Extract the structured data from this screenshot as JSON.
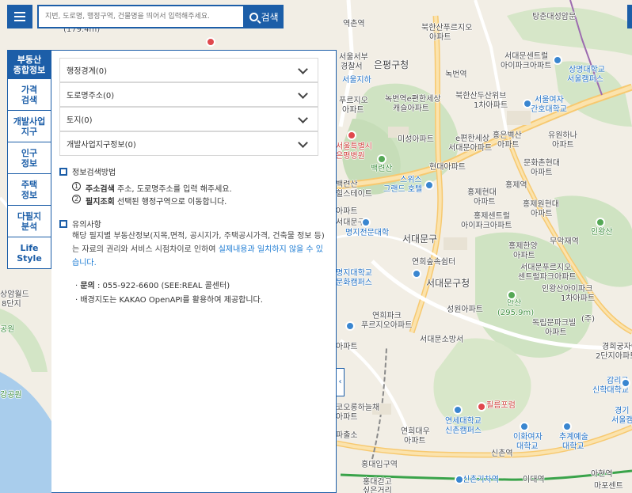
{
  "search": {
    "placeholder": "지번, 도로명, 행정구역, 건물명을 띄어서 입력해주세요.",
    "button": "검색"
  },
  "tabs": [
    {
      "label": "부동산\n종합정보"
    },
    {
      "label": "가격\n검색"
    },
    {
      "label": "개발사업\n지구"
    },
    {
      "label": "인구\n정보"
    },
    {
      "label": "주택\n정보"
    },
    {
      "label": "다필지\n분석"
    },
    {
      "label": "Life\nStyle"
    }
  ],
  "accordion": [
    "행정경계(0)",
    "도로명주소(0)",
    "토지(0)",
    "개발사업지구정보(0)"
  ],
  "guide": {
    "title": "정보검색방법",
    "steps": [
      {
        "num": "1",
        "strong": "주소검색",
        "text": "주소, 도로명주소를 입력 해주세요."
      },
      {
        "num": "2",
        "strong": "필지조회",
        "text": "선택된 행정구역으로 이동합니다."
      }
    ]
  },
  "caution": {
    "title": "유의사항",
    "text1": "해당 필지별 부동산정보(지목,면적, 공시지가, 주택공시가격, 건축물 정보 등)는 자료의 권리와 서비스 시점차이로 인하여 ",
    "highlight": "실제내용과 일치하지 않을 수 있습니다.",
    "contact_label": "문의",
    "contact_text": " : 055-922-6600 (SEE:REAL 콜센터)",
    "map_note": "배경지도는 KAKAO OpenAPI를 활용하여 제공합니다."
  },
  "collapse_icon": "chevron-left-icon",
  "map_labels": {
    "l01": "(179.4m)",
    "l02": "역촌역",
    "l03": "북한산푸르지오",
    "l04": "아파트",
    "l05": "탕춘대성암문",
    "l06": "서울서부",
    "l07": "경찰서",
    "l08": "은평구청",
    "l09": "녹번역",
    "l10": "서대문센트럴",
    "l11": "아이파크아파트",
    "l12": "상명대학교",
    "l13": "서울캠퍼스",
    "l14": "푸르지오",
    "l15": "아파트",
    "l16": "녹번역e편한세상",
    "l17": "캐슬아파트",
    "l18": "북한산두산위브",
    "l19": "1차아파트",
    "l20": "서울여자",
    "l21": "간호대학교",
    "l22": "서울특별시",
    "l23": "은평병원",
    "l24": "미성아파트",
    "l25": "e편한세상",
    "l26": "서대문아파트",
    "l27": "홍은벽산",
    "l28": "아파트",
    "l29": "유원하나",
    "l30": "아파트",
    "l31": "백련산",
    "l32": "문화촌현대",
    "l33": "아파트",
    "l34": "현대아파트",
    "l35": "스위스",
    "l36": "그랜드 호텔",
    "l37": "백련산",
    "l38": "힐스테이트",
    "l39": "홍제역",
    "l40": "홍제현대",
    "l41": "아파트",
    "l42": "홍제센트럴",
    "l43": "아이파크아파트",
    "l44": "홍제원현대",
    "l45": "아파트",
    "l46": "명지전문대학",
    "l47": "서대문구",
    "l48": "무악재역",
    "l49": "인왕산",
    "l50": "홍제한양",
    "l51": "아파트",
    "l52": "연희숲속쉼터",
    "l53": "서대문푸르지오",
    "l54": "센트럴파크아파트",
    "l55": "서대문구청",
    "l56": "인왕산아이파크",
    "l57": "1차아파트",
    "l58": "명지대학교",
    "l59": "문화캠퍼스",
    "l60": "상암월드",
    "l61": "8단지",
    "l62": "성원아파트",
    "l63": "안산",
    "l64": "(295.9m)",
    "l65": "연희파크",
    "l66": "푸르지오아파트",
    "l67": "독립문파크빌",
    "l68": "아파트",
    "l69": "공원",
    "l70": "서대문소방서",
    "l71": "경희궁자이",
    "l72": "2단지아파트",
    "l73": "감리교",
    "l74": "신학대학교",
    "l75": "강공원",
    "l76": "코오롱하늘채",
    "l77": "아파트",
    "l78": "필름포럼",
    "l79": "경기",
    "l80": "서울캠",
    "l81": "연세대학교",
    "l82": "신촌캠퍼스",
    "l83": "연희대우",
    "l84": "아파트",
    "l85": "이화여자",
    "l86": "대학교",
    "l87": "추계예술",
    "l88": "대학교",
    "l89": "파출소",
    "l90": "신촌역",
    "l91": "홍대입구역",
    "l92": "신촌기차역",
    "l93": "이대역",
    "l94": "아현역",
    "l95": "마포센트",
    "l96": "홍대걷고",
    "l97": "싶은거리",
    "l98": "아파트",
    "l99": "(주)",
    "l100": "서울지하",
    "l101": "아파트",
    "l102": "서대문구"
  }
}
